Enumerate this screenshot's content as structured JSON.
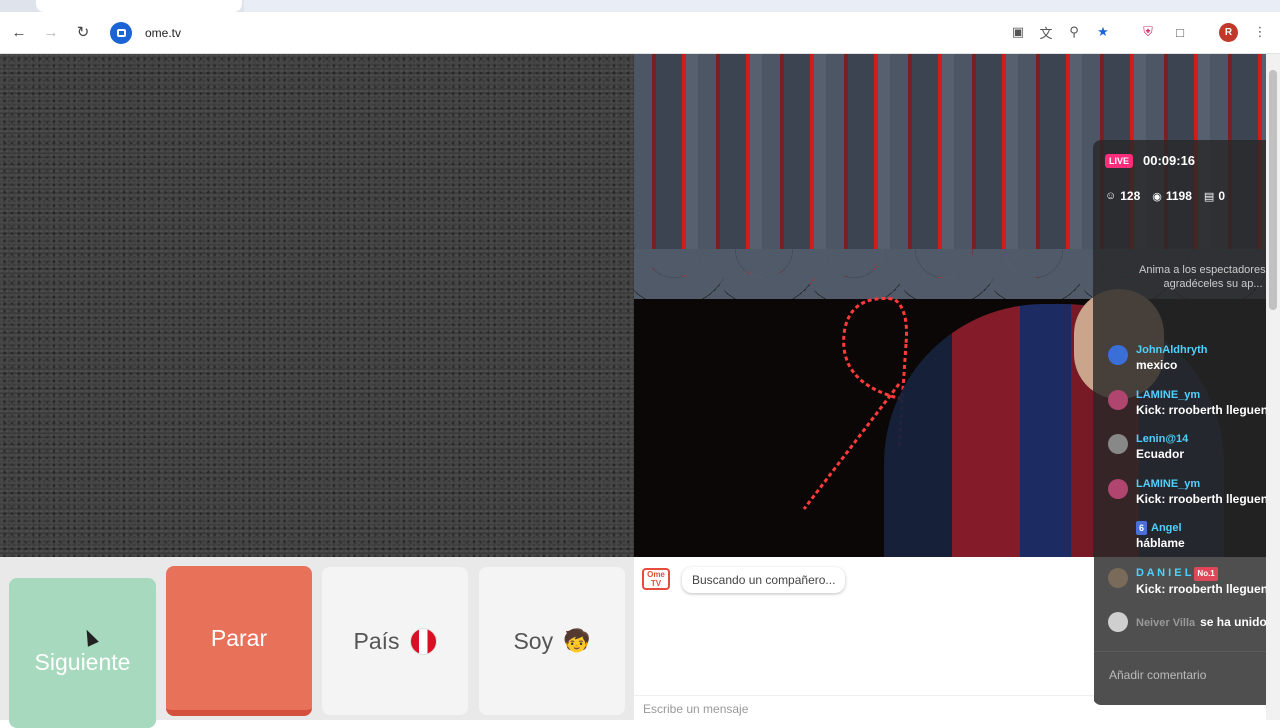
{
  "browser": {
    "url": "ome.tv",
    "profile_initial": "R",
    "icons": [
      "back-icon",
      "forward-icon",
      "reload-icon",
      "install-icon",
      "translate-icon",
      "zoom-icon",
      "bookmark-star-icon",
      "shield-extension-icon",
      "extensions-puzzle-icon",
      "menu-dots-icon"
    ]
  },
  "controls": {
    "next_label": "Siguiente",
    "stop_label": "Parar",
    "country_label": "País",
    "gender_label": "Soy",
    "gender_emoji": "🧒"
  },
  "textchat": {
    "logo_text": "Ome TV",
    "status": "Buscando un compañero...",
    "placeholder": "Escribe un mensaje"
  },
  "live": {
    "badge": "LIVE",
    "timer": "00:09:16",
    "followers": "128",
    "viewers": "1198",
    "gifts": "0",
    "prompt": "Anima a los espectadores a ... agradéceles su ap...",
    "comment_placeholder": "Añadir comentario",
    "messages": [
      {
        "name": "JohnAldhryth",
        "text": "mexico",
        "avatar_color": "#3a6fd8"
      },
      {
        "name": "LAMINE_ym",
        "text": "Kick: rrooberth lleguen y c",
        "avatar_color": "#b0456f"
      },
      {
        "name": "Lenin@14",
        "text": "Ecuador",
        "avatar_color": "#888888"
      },
      {
        "name": "LAMINE_ym",
        "text": "Kick: rrooberth lleguen y c",
        "avatar_color": "#b0456f"
      },
      {
        "name": "Angel",
        "level": "6",
        "text": "háblame",
        "avatar_color": ""
      },
      {
        "name": "D A N I E L",
        "rank": "No.1",
        "text": "Kick: rrooberth lleguen y c",
        "avatar_color": "#7a6a5a"
      }
    ],
    "join": {
      "name": "Neiver Villa",
      "text": "se ha unido"
    }
  }
}
